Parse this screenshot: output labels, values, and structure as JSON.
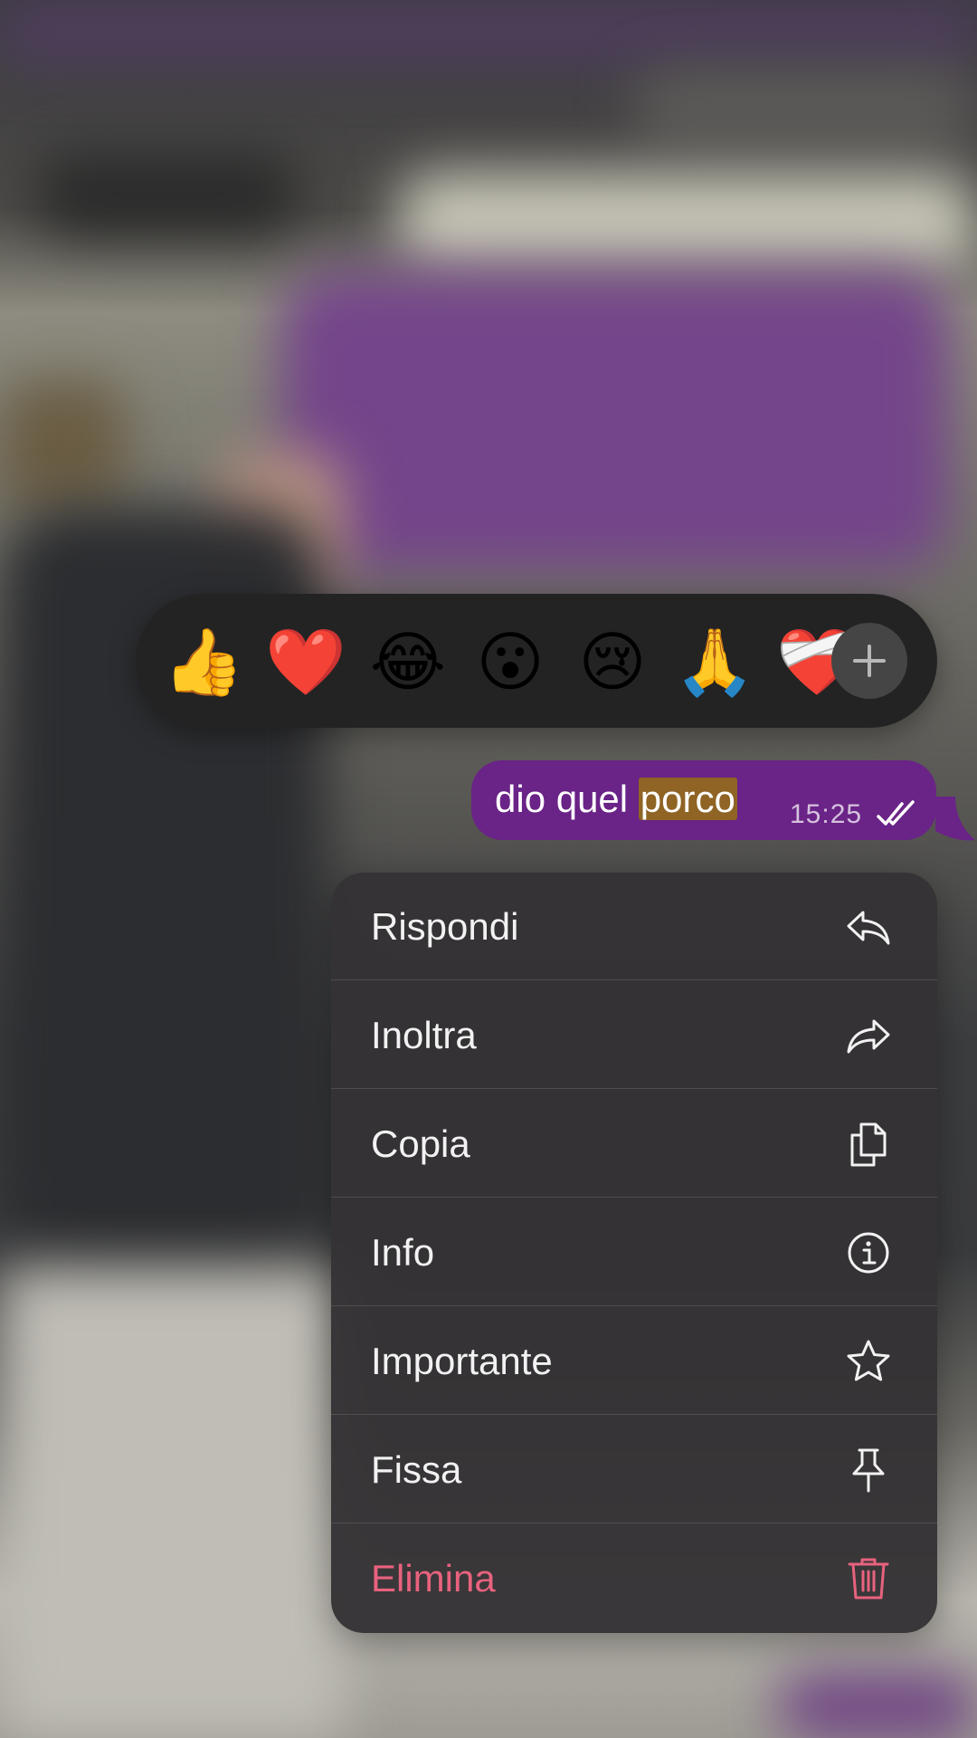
{
  "reactions": {
    "emojis": [
      {
        "icon": "thumbs-up",
        "char": "👍"
      },
      {
        "icon": "red-heart",
        "char": "❤️"
      },
      {
        "icon": "face-with-tears-of-joy",
        "char": "😂"
      },
      {
        "icon": "face-with-open-mouth",
        "char": "😮"
      },
      {
        "icon": "crying-face",
        "char": "😢"
      },
      {
        "icon": "folded-hands",
        "char": "🙏"
      },
      {
        "icon": "mending-heart",
        "char": "❤️‍🩹"
      }
    ],
    "more_icon": "plus-icon"
  },
  "message": {
    "text_before": "dio quel ",
    "text_highlight": "porco",
    "time": "15:25",
    "status_icon": "double-check-icon",
    "bubble_color": "#6a2387",
    "highlight_color": "#8f6424"
  },
  "menu": {
    "items": [
      {
        "label": "Rispondi",
        "icon": "reply-icon"
      },
      {
        "label": "Inoltra",
        "icon": "forward-icon"
      },
      {
        "label": "Copia",
        "icon": "copy-icon"
      },
      {
        "label": "Info",
        "icon": "info-icon"
      },
      {
        "label": "Importante",
        "icon": "star-icon"
      },
      {
        "label": "Fissa",
        "icon": "pin-icon"
      },
      {
        "label": "Elimina",
        "icon": "trash-icon",
        "destructive": true
      }
    ],
    "destructive_color": "#e8627e"
  }
}
